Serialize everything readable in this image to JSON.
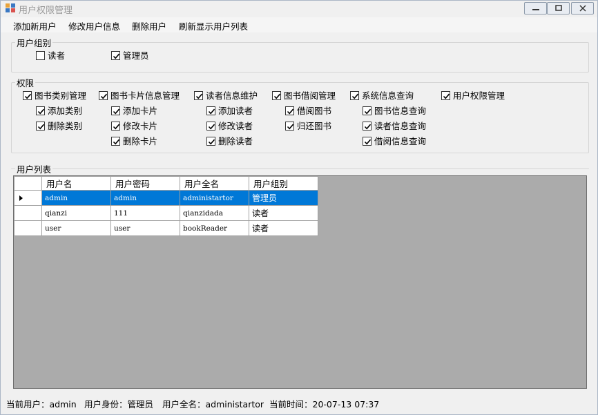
{
  "window": {
    "title": "用户权限管理"
  },
  "menu": {
    "items": [
      "添加新用户",
      "修改用户信息",
      "删除用户",
      "刷新显示用户列表"
    ]
  },
  "user_group": {
    "legend": "用户组别",
    "options": [
      {
        "label": "读者",
        "checked": false
      },
      {
        "label": "管理员",
        "checked": true
      }
    ]
  },
  "permissions": {
    "legend": "权限",
    "columns": [
      {
        "label": "图书类别管理",
        "checked": true,
        "children": [
          {
            "label": "添加类别",
            "checked": true
          },
          {
            "label": "删除类别",
            "checked": true
          }
        ]
      },
      {
        "label": "图书卡片信息管理",
        "checked": true,
        "children": [
          {
            "label": "添加卡片",
            "checked": true
          },
          {
            "label": "修改卡片",
            "checked": true
          },
          {
            "label": "删除卡片",
            "checked": true
          }
        ]
      },
      {
        "label": "读者信息维护",
        "checked": true,
        "children": [
          {
            "label": "添加读者",
            "checked": true
          },
          {
            "label": "修改读者",
            "checked": true
          },
          {
            "label": "删除读者",
            "checked": true
          }
        ]
      },
      {
        "label": "图书借阅管理",
        "checked": true,
        "children": [
          {
            "label": "借阅图书",
            "checked": true
          },
          {
            "label": "归还图书",
            "checked": true
          }
        ]
      },
      {
        "label": "系统信息查询",
        "checked": true,
        "children": [
          {
            "label": "图书信息查询",
            "checked": true
          },
          {
            "label": "读者信息查询",
            "checked": true
          },
          {
            "label": "借阅信息查询",
            "checked": true
          }
        ]
      },
      {
        "label": "用户权限管理",
        "checked": true,
        "children": []
      }
    ]
  },
  "user_list": {
    "legend": "用户列表",
    "headers": [
      "用户名",
      "用户密码",
      "用户全名",
      "用户组别"
    ],
    "rows": [
      {
        "cells": [
          "admin",
          "admin",
          "administartor",
          "管理员"
        ],
        "selected": true
      },
      {
        "cells": [
          "qianzi",
          "111",
          "qianzidada",
          "读者"
        ],
        "selected": false
      },
      {
        "cells": [
          "user",
          "user",
          "bookReader",
          "读者"
        ],
        "selected": false
      }
    ]
  },
  "status": {
    "current_user": "当前用户：admin",
    "user_role": "用户身份：管理员",
    "user_fullname": "用户全名：administartor",
    "current_time": "当前时间：20-07-13 07:37"
  }
}
